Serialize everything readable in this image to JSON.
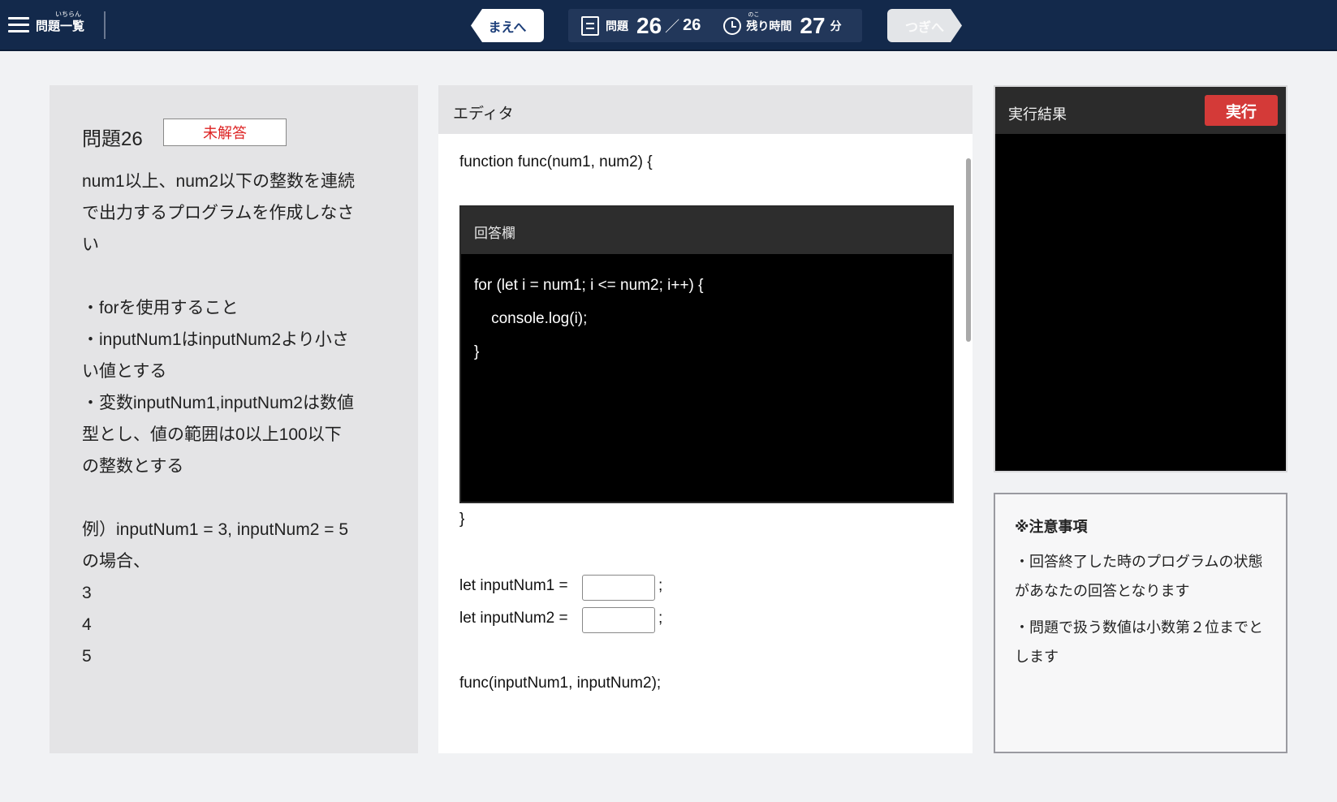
{
  "topbar": {
    "menu_ruby": "いちらん",
    "menu_label": "問題一覧",
    "prev_label": "まえへ",
    "next_label": "つぎへ",
    "question_label": "問題",
    "current_question": "26",
    "slash": "／",
    "total_questions": "26",
    "time_ruby": "のこ",
    "time_label": "残り時間",
    "time_remaining": "27",
    "time_unit": "分",
    "icons": {
      "menu": "hamburger-icon",
      "question": "document-icon",
      "time": "clock-icon"
    }
  },
  "question": {
    "title": "問題26",
    "status_badge": "未解答",
    "lines": [
      "num1以上、num2以下の整数を連続",
      "で出力するプログラムを作成しなさ",
      "い",
      "",
      "・forを使用すること",
      "・inputNum1はinputNum2より小さ",
      "い値とする",
      "・変数inputNum1,inputNum2は数値",
      "型とし、値の範囲は0以上100以下",
      "の整数とする",
      "",
      "例）inputNum1 = 3, inputNum2 = 5",
      "の場合、",
      "3",
      "4",
      "5"
    ]
  },
  "editor": {
    "header": "エディタ",
    "function_open": "function func(num1, num2) {",
    "answer_header": "回答欄",
    "answer_code": "for (let i = num1; i <= num2; i++) {\n    console.log(i);\n}",
    "function_close": "}",
    "input1_label": "let inputNum1 =",
    "input1_value": "",
    "input2_label": "let inputNum2 =",
    "input2_value": "",
    "semicolon": ";",
    "call_line": "func(inputNum1, inputNum2);"
  },
  "result": {
    "header": "実行結果",
    "run_label": "実行",
    "output": ""
  },
  "notes": {
    "title": "※注意事項",
    "items": [
      "・回答終了した時のプログラムの状態があなたの回答となります",
      "・問題で扱う数値は小数第２位までとします"
    ]
  },
  "colors": {
    "topbar_bg": "#13294b",
    "run_button": "#d43a38",
    "badge_text": "#dd2222"
  }
}
